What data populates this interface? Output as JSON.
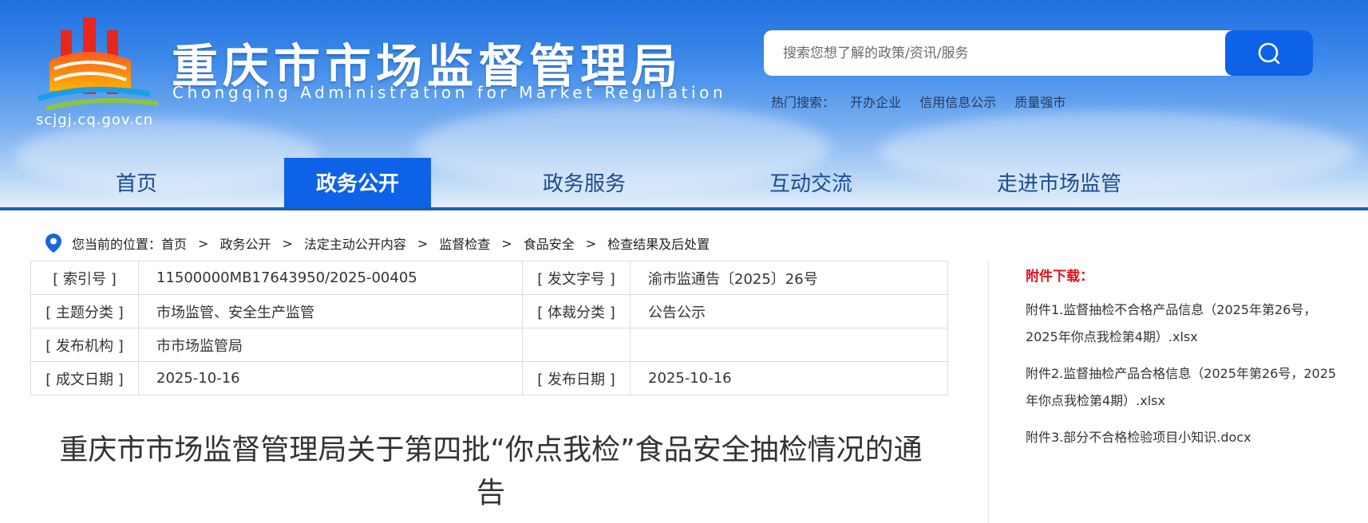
{
  "header": {
    "site_title": "重庆市市场监督管理局",
    "site_subtitle": "Chongqing  Administration for Market Regulation",
    "domain": "scjgj.cq.gov.cn",
    "colors": {
      "primary": "#0d62e8",
      "active_underline": "#d6101b"
    }
  },
  "search": {
    "placeholder": "搜索您想了解的政策/资讯/服务",
    "button_icon": "search-icon",
    "hot_label": "热门搜索：",
    "hot_terms": [
      "开办企业",
      "信用信息公示",
      "质量强市"
    ]
  },
  "nav": {
    "items": [
      {
        "label": "首页"
      },
      {
        "label": "政务公开",
        "active": true
      },
      {
        "label": "政务服务"
      },
      {
        "label": "互动交流"
      },
      {
        "label": "走进市场监管"
      }
    ]
  },
  "breadcrumb": {
    "prefix": "您当前的位置：",
    "items": [
      "首页",
      "政务公开",
      "法定主动公开内容",
      "监督检查",
      "食品安全",
      "检查结果及后处置"
    ],
    "separator": ">"
  },
  "meta": {
    "index_label": "[ 索引号 ]",
    "index_value": "11500000MB17643950/2025-00405",
    "doc_no_label": "[ 发文字号 ]",
    "doc_no_value": "渝市监通告〔2025〕26号",
    "topic_label": "[ 主题分类 ]",
    "topic_value": "市场监管、安全生产监管",
    "genre_label": "[ 体裁分类 ]",
    "genre_value": "公告公示",
    "org_label": "[ 发布机构 ]",
    "org_value": "市市场监管局",
    "written_label": "[ 成文日期 ]",
    "written_value": "2025-10-16",
    "publish_label": "[ 发布日期 ]",
    "publish_value": "2025-10-16"
  },
  "document": {
    "title": "重庆市市场监督管理局关于第四批“你点我检”食品安全抽检情况的通告"
  },
  "attachments": {
    "title": "附件下载：",
    "items": [
      "附件1.监督抽检不合格产品信息（2025年第26号，2025年你点我检第4期）.xlsx",
      "附件2.监督抽检产品合格信息（2025年第26号，2025年你点我检第4期）.xlsx",
      "附件3.部分不合格检验项目小知识.docx"
    ]
  }
}
